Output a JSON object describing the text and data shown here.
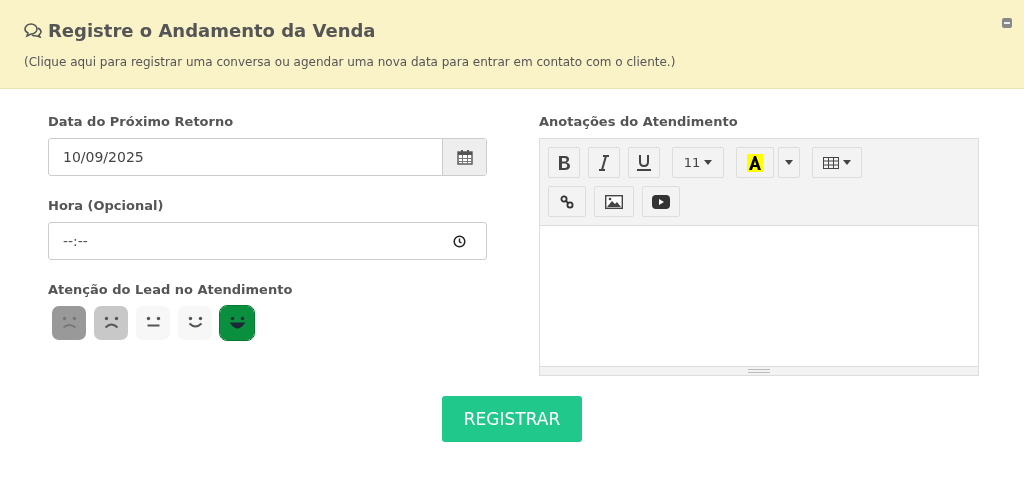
{
  "panel": {
    "title": "Registre o Andamento da Venda",
    "subtitle": "(Clique aqui para registrar uma conversa ou agendar uma nova data para entrar em contato com o cliente.)"
  },
  "date_field": {
    "label": "Data do Próximo Retorno",
    "value": "10/09/2025"
  },
  "time_field": {
    "label": "Hora (Opcional)",
    "placeholder": "--:--"
  },
  "attention": {
    "label": "Atenção do Lead no Atendimento",
    "ratings": [
      {
        "kind": "very-sad",
        "color": "#999999",
        "selected": false
      },
      {
        "kind": "sad",
        "color": "#c8c8c8",
        "selected": false
      },
      {
        "kind": "neutral",
        "color": "#f7f7f7",
        "selected": false
      },
      {
        "kind": "happy",
        "color": "#f7f7f7",
        "selected": false
      },
      {
        "kind": "very-happy",
        "color": "#0a8f3e",
        "selected": true
      }
    ]
  },
  "notes": {
    "label": "Anotações do Atendimento",
    "font_size": "11"
  },
  "submit": "REGISTRAR"
}
